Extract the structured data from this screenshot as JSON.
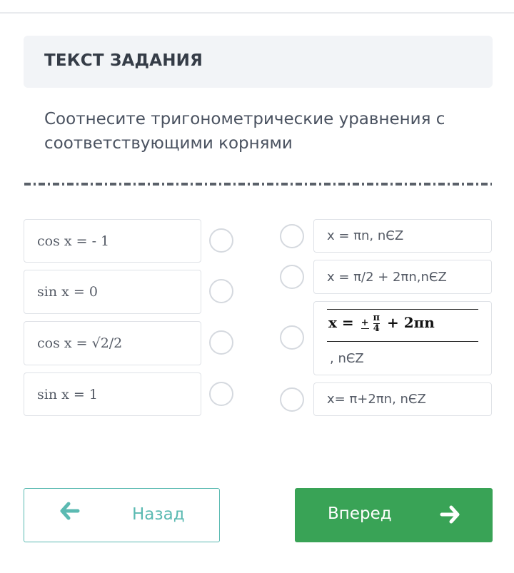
{
  "header": {
    "title": "ТЕКСТ ЗАДАНИЯ"
  },
  "question": {
    "text": "Соотнесите тригонометрические уравнения с соответствующими корнями"
  },
  "left_items": [
    {
      "label": "cos x = - 1"
    },
    {
      "label": "sin x = 0"
    },
    {
      "label": "cos x = √2/2"
    },
    {
      "label": "sin x = 1"
    }
  ],
  "right_items": [
    {
      "label": "x = πn, nЄZ"
    },
    {
      "label": "x = π/2 + 2πn,nЄZ"
    },
    {
      "label": "x = ± π/4 + 2πn",
      "formula": {
        "prefix": "x = ",
        "sign": "+",
        "num": "π",
        "den": "4",
        "tail": " + 2πn"
      },
      "suffix": ", nЄZ"
    },
    {
      "label": "x= π+2πn, nЄZ"
    }
  ],
  "navigation": {
    "back_label": "Назад",
    "next_label": "Вперед",
    "back_icon": "arrow-left-icon",
    "next_icon": "arrow-right-icon"
  },
  "colors": {
    "accent_teal": "#5bbab2",
    "primary_green": "#39a356",
    "header_bg": "#f2f4f7"
  }
}
